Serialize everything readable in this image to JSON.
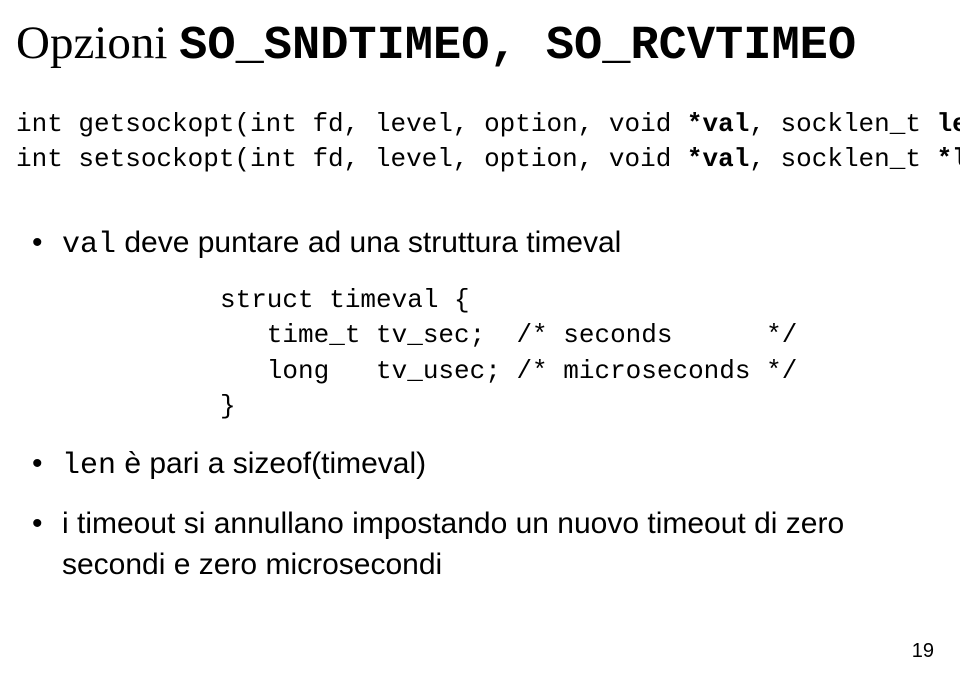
{
  "title": {
    "opzioni": "Opzioni ",
    "mono": "SO_SNDTIMEO, SO_RCVTIMEO"
  },
  "decl": {
    "line1_a": "int getsockopt(int fd, level, option, void ",
    "line1_b": "*val",
    "line1_c": ", socklen_t ",
    "line1_d": "len",
    "line1_e": ");",
    "line2_a": "int setsockopt(int fd, level, option, void ",
    "line2_b": "*val",
    "line2_c": ", socklen_t ",
    "line2_d": "*len",
    "line2_e": ");"
  },
  "bullets": {
    "b1_a": "val",
    "b1_b": " deve puntare ad una struttura timeval",
    "struct_l1": "struct timeval {",
    "struct_l2": "   time_t tv_sec;  /* seconds      */",
    "struct_l3": "   long   tv_usec; /* microseconds */",
    "struct_l4": "}",
    "b2_a": "len",
    "b2_b": " è pari a sizeof(timeval)",
    "b3": "i timeout si annullano impostando un nuovo timeout di zero secondi e zero microsecondi"
  },
  "page_number": "19"
}
